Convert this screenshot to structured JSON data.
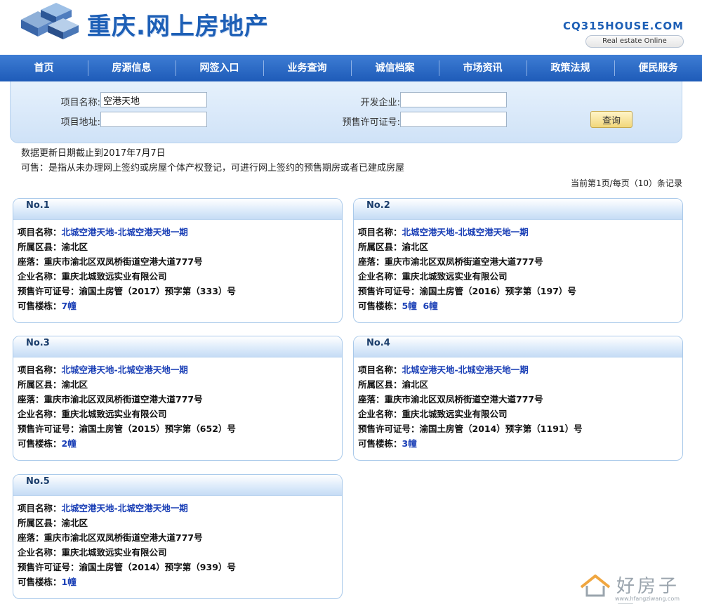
{
  "header": {
    "title": "重庆.网上房地产",
    "domain": "CQ315HOUSE.COM",
    "tagline": "Real estate Online"
  },
  "nav": {
    "items": [
      "首页",
      "房源信息",
      "网签入口",
      "业务查询",
      "诚信档案",
      "市场资讯",
      "政策法规",
      "便民服务"
    ]
  },
  "search": {
    "project_name_label": "项目名称:",
    "project_name_value": "空港天地",
    "project_address_label": "项目地址:",
    "project_address_value": "",
    "developer_label": "开发企业:",
    "developer_value": "",
    "presale_label": "预售许可证号:",
    "presale_value": "",
    "query_button": "查询"
  },
  "notes": {
    "update_date": "数据更新日期截止到2017年7月7日",
    "available_def": "可售：是指从未办理网上签约或房屋个体产权登记，可进行网上签约的预售期房或者已建成房屋"
  },
  "pager": "当前第1页/每页（10）条记录",
  "labels": {
    "project": "项目名称：",
    "district": "所属区县：",
    "location": "座落：",
    "company": "企业名称：",
    "permit": "预售许可证号：",
    "buildings": "可售楼栋："
  },
  "results": [
    {
      "no": "No.1",
      "project": "北城空港天地-北城空港天地一期",
      "district": "渝北区",
      "location": "重庆市渝北区双凤桥街道空港大道777号",
      "company": "重庆北城致远实业有限公司",
      "permit": "渝国土房管（2017）预字第（333）号",
      "buildings": [
        "7幢"
      ]
    },
    {
      "no": "No.2",
      "project": "北城空港天地-北城空港天地一期",
      "district": "渝北区",
      "location": "重庆市渝北区双凤桥街道空港大道777号",
      "company": "重庆北城致远实业有限公司",
      "permit": "渝国土房管（2016）预字第（197）号",
      "buildings": [
        "5幢",
        "6幢"
      ]
    },
    {
      "no": "No.3",
      "project": "北城空港天地-北城空港天地一期",
      "district": "渝北区",
      "location": "重庆市渝北区双凤桥街道空港大道777号",
      "company": "重庆北城致远实业有限公司",
      "permit": "渝国土房管（2015）预字第（652）号",
      "buildings": [
        "2幢"
      ]
    },
    {
      "no": "No.4",
      "project": "北城空港天地-北城空港天地一期",
      "district": "渝北区",
      "location": "重庆市渝北区双凤桥街道空港大道777号",
      "company": "重庆北城致远实业有限公司",
      "permit": "渝国土房管（2014）预字第（1191）号",
      "buildings": [
        "3幢"
      ]
    },
    {
      "no": "No.5",
      "project": "北城空港天地-北城空港天地一期",
      "district": "渝北区",
      "location": "重庆市渝北区双凤桥街道空港大道777号",
      "company": "重庆北城致远实业有限公司",
      "permit": "渝国土房管（2014）预字第（939）号",
      "buildings": [
        "1幢"
      ]
    }
  ],
  "watermark": {
    "text": "好房子网",
    "url": "www.hfangziwang.com"
  }
}
